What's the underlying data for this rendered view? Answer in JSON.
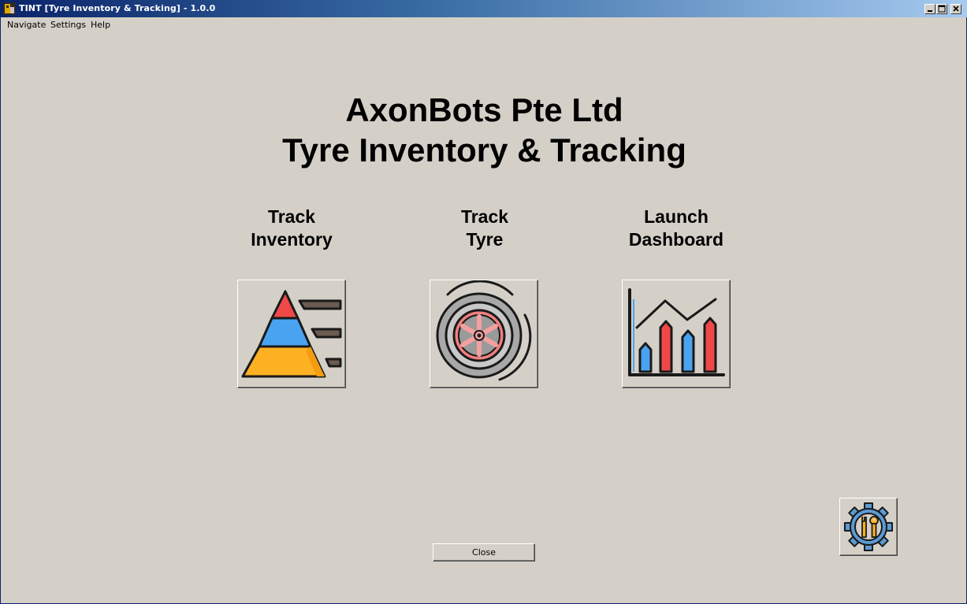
{
  "window": {
    "title": "TINT [Tyre Inventory & Tracking] - 1.0.0",
    "controls": [
      "minimize-icon",
      "maximize-icon",
      "close-icon"
    ]
  },
  "menu": {
    "navigate": "Navigate",
    "settings": "Settings",
    "help": "Help"
  },
  "header": {
    "company": "AxonBots Pte Ltd",
    "subtitle": "Tyre Inventory & Tracking"
  },
  "tiles": [
    {
      "line1": "Track",
      "line2": "Inventory",
      "icon": "pyramid-chart-icon"
    },
    {
      "line1": "Track",
      "line2": "Tyre",
      "icon": "tyre-icon"
    },
    {
      "line1": "Launch",
      "line2": "Dashboard",
      "icon": "bar-line-chart-icon"
    }
  ],
  "footer": {
    "close_label": "Close",
    "settings_icon": "gear-wrench-icon"
  },
  "colors": {
    "window_bg": "#d4d0c8",
    "titlebar_start": "#0a246a",
    "titlebar_end": "#a6caf0",
    "red": "#f04848",
    "blue": "#4aa3f0",
    "orange": "#fdb022"
  }
}
